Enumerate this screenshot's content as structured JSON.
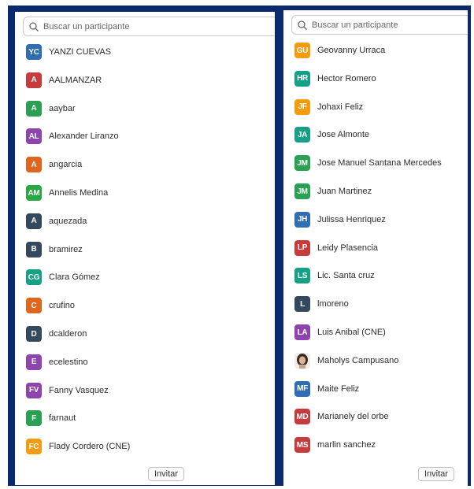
{
  "left_panel": {
    "search_placeholder": "Buscar un participante",
    "invite_label": "Invitar",
    "participants": [
      {
        "initials": "YC",
        "name": "YANZI CUEVAS",
        "color": "#2f6eb2"
      },
      {
        "initials": "A",
        "name": "AALMANZAR",
        "color": "#c63c3c"
      },
      {
        "initials": "A",
        "name": "aaybar",
        "color": "#2aa152"
      },
      {
        "initials": "AL",
        "name": "Alexander Liranzo",
        "color": "#8e44ad"
      },
      {
        "initials": "A",
        "name": "angarcia",
        "color": "#e0651f"
      },
      {
        "initials": "AM",
        "name": "Annelis Medina",
        "color": "#28a745"
      },
      {
        "initials": "A",
        "name": "aquezada",
        "color": "#34495e"
      },
      {
        "initials": "B",
        "name": "bramirez",
        "color": "#34495e"
      },
      {
        "initials": "CG",
        "name": "Clara Gómez",
        "color": "#16a085"
      },
      {
        "initials": "C",
        "name": "crufino",
        "color": "#e0651f"
      },
      {
        "initials": "D",
        "name": "dcalderon",
        "color": "#34495e"
      },
      {
        "initials": "E",
        "name": "ecelestino",
        "color": "#8e44ad"
      },
      {
        "initials": "FV",
        "name": "Fanny Vasquez",
        "color": "#8e44ad"
      },
      {
        "initials": "F",
        "name": "farnaut",
        "color": "#2aa152"
      },
      {
        "initials": "FC",
        "name": "Flady Cordero (CNE)",
        "color": "#f39c12"
      }
    ]
  },
  "right_panel": {
    "search_placeholder": "Buscar un participante",
    "invite_label": "Invitar",
    "participants": [
      {
        "initials": "GU",
        "name": "Geovanny Urraca",
        "color": "#f39c12"
      },
      {
        "initials": "HR",
        "name": "Hector Romero",
        "color": "#16a085"
      },
      {
        "initials": "JF",
        "name": "Johaxi Feliz",
        "color": "#f39c12"
      },
      {
        "initials": "JA",
        "name": "Jose Almonte",
        "color": "#16a085"
      },
      {
        "initials": "JM",
        "name": "Jose Manuel Santana Mercedes",
        "color": "#2aa152"
      },
      {
        "initials": "JM",
        "name": "Juan Martinez",
        "color": "#2aa152"
      },
      {
        "initials": "JH",
        "name": "Julissa Henriquez",
        "color": "#2f6eb2"
      },
      {
        "initials": "LP",
        "name": "Leidy Plasencia",
        "color": "#c63c3c"
      },
      {
        "initials": "LS",
        "name": "Lic. Santa cruz",
        "color": "#16a085"
      },
      {
        "initials": "L",
        "name": "lmoreno",
        "color": "#34495e"
      },
      {
        "initials": "LA",
        "name": "Luis Anibal (CNE)",
        "color": "#8e44ad"
      },
      {
        "initials": "",
        "name": "Maholys Campusano",
        "color": "#f1ece6",
        "photo": true
      },
      {
        "initials": "MF",
        "name": "Maite Feliz",
        "color": "#2f6eb2"
      },
      {
        "initials": "MD",
        "name": "Marianely del orbe",
        "color": "#c63c3c"
      },
      {
        "initials": "MS",
        "name": "marlin sanchez",
        "color": "#c63c3c"
      }
    ]
  }
}
